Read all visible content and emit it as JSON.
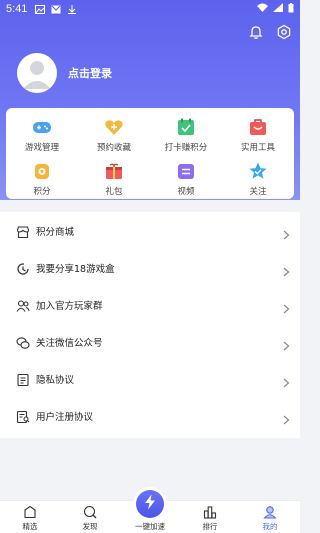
{
  "status_bar": {
    "time": "5:41"
  },
  "profile": {
    "login_label": "点击登录"
  },
  "grid": {
    "row1": [
      {
        "label": "游戏管理",
        "icon": "gamepad-icon",
        "color": "#4aa3f0"
      },
      {
        "label": "预约收藏",
        "icon": "heart-plus-icon",
        "color": "#f4b740"
      },
      {
        "label": "打卡赚积分",
        "icon": "checkin-icon",
        "color": "#3fc47a"
      },
      {
        "label": "实用工具",
        "icon": "toolbox-icon",
        "color": "#f25a5a"
      }
    ],
    "row2": [
      {
        "label": "积分",
        "icon": "points-icon",
        "color": "#f6b43c"
      },
      {
        "label": "礼包",
        "icon": "gift-icon",
        "color": "#ef5a5a"
      },
      {
        "label": "视频",
        "icon": "video-icon",
        "color": "#8c6cf0"
      },
      {
        "label": "关注",
        "icon": "star-follow-icon",
        "color": "#3aa8f0"
      }
    ]
  },
  "menu": {
    "items": [
      {
        "label": "积分商城",
        "icon": "shop-icon"
      },
      {
        "label": "我要分享18游戏盒",
        "icon": "share-icon"
      },
      {
        "label": "加入官方玩家群",
        "icon": "group-icon"
      },
      {
        "label": "关注微信公众号",
        "icon": "wechat-icon"
      },
      {
        "label": "隐私协议",
        "icon": "privacy-doc-icon"
      },
      {
        "label": "用户注册协议",
        "icon": "register-doc-icon"
      }
    ]
  },
  "tabbar": {
    "tabs": [
      {
        "label": "精选",
        "icon": "featured-icon"
      },
      {
        "label": "发现",
        "icon": "discover-icon"
      },
      {
        "label": "一键加速",
        "icon": "lightning-icon"
      },
      {
        "label": "排行",
        "icon": "ranking-icon"
      },
      {
        "label": "我的",
        "icon": "profile-icon"
      }
    ],
    "active_color": "#4f6bea"
  },
  "colors": {
    "header_gradient_top": "#5c62ee",
    "header_gradient_bottom": "#8a92f5"
  }
}
